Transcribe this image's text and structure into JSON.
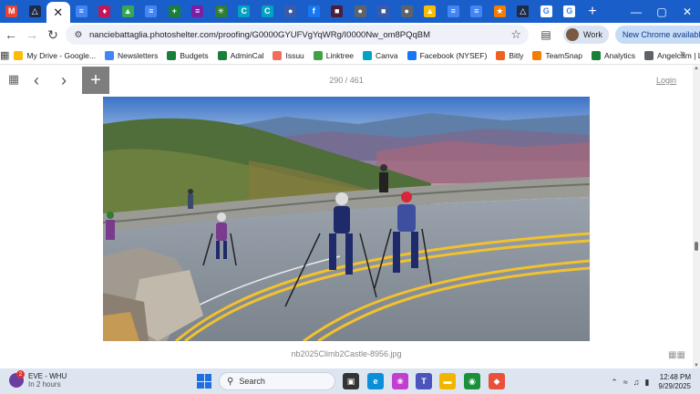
{
  "window": {
    "controls": {
      "minimize": "—",
      "maximize": "▢",
      "close": "✕"
    }
  },
  "tabs": [
    {
      "icon": "gmail-icon",
      "glyph": "M",
      "color": "#ea4335"
    },
    {
      "icon": "photoshelter-icon",
      "glyph": "△",
      "color": "#1c2b4a"
    },
    {
      "icon": "close-tab-icon",
      "glyph": "✕",
      "color": "#ffffff",
      "active": true
    },
    {
      "icon": "docs-icon",
      "glyph": "≡",
      "color": "#4285f4"
    },
    {
      "icon": "app-icon",
      "glyph": "♦",
      "color": "#c2185b"
    },
    {
      "icon": "drive-icon",
      "glyph": "▲",
      "color": "#34a853"
    },
    {
      "icon": "docs-icon",
      "glyph": "≡",
      "color": "#4285f4"
    },
    {
      "icon": "sheets-icon",
      "glyph": "+",
      "color": "#188038"
    },
    {
      "icon": "forms-icon",
      "glyph": "≡",
      "color": "#7b1fa2"
    },
    {
      "icon": "linktree-icon",
      "glyph": "✳",
      "color": "#2e7d32"
    },
    {
      "icon": "canva-icon",
      "glyph": "C",
      "color": "#00a3c4"
    },
    {
      "icon": "canva-icon",
      "glyph": "C",
      "color": "#00a3c4"
    },
    {
      "icon": "app-icon",
      "glyph": "●",
      "color": "#3b5ba9"
    },
    {
      "icon": "facebook-icon",
      "glyph": "f",
      "color": "#1877f2"
    },
    {
      "icon": "app-icon",
      "glyph": "■",
      "color": "#4a1f3a"
    },
    {
      "icon": "app-icon",
      "glyph": "●",
      "color": "#5f6368"
    },
    {
      "icon": "app-icon",
      "glyph": "■",
      "color": "#3b5ba9"
    },
    {
      "icon": "app-icon",
      "glyph": "●",
      "color": "#5f6368"
    },
    {
      "icon": "drive-icon",
      "glyph": "▲",
      "color": "#fbbc04"
    },
    {
      "icon": "docs-icon",
      "glyph": "≡",
      "color": "#4285f4"
    },
    {
      "icon": "docs-icon",
      "glyph": "≡",
      "color": "#4285f4"
    },
    {
      "icon": "app-icon",
      "glyph": "★",
      "color": "#f57c00"
    },
    {
      "icon": "photoshelter-icon",
      "glyph": "△",
      "color": "#1c2b4a"
    },
    {
      "icon": "google-icon",
      "glyph": "G",
      "color": "#ffffff"
    },
    {
      "icon": "google-icon",
      "glyph": "G",
      "color": "#ffffff"
    }
  ],
  "toolbar": {
    "url": "nanciebattaglia.photoshelter.com/proofing/G0000GYUFVgYqWRg/I0000Nw_om8PQqBM",
    "profile_label": "Work",
    "update_label": "New Chrome available"
  },
  "bookmarks": [
    {
      "label": "My Drive - Google...",
      "icon": "drive-icon",
      "color": "#fbbc04"
    },
    {
      "label": "Newsletters",
      "icon": "docs-icon",
      "color": "#4285f4"
    },
    {
      "label": "Budgets",
      "icon": "sheets-icon",
      "color": "#188038"
    },
    {
      "label": "AdminCal",
      "icon": "sheets-icon",
      "color": "#188038"
    },
    {
      "label": "Issuu",
      "icon": "issuu-icon",
      "color": "#f36d5d"
    },
    {
      "label": "Linktree",
      "icon": "linktree-icon",
      "color": "#43a047"
    },
    {
      "label": "Canva",
      "icon": "canva-icon",
      "color": "#00a3c4"
    },
    {
      "label": "Facebook (NYSEF)",
      "icon": "facebook-icon",
      "color": "#1877f2"
    },
    {
      "label": "Bitly",
      "icon": "bitly-icon",
      "color": "#ee6123"
    },
    {
      "label": "TeamSnap",
      "icon": "teamsnap-icon",
      "color": "#f57c00"
    },
    {
      "label": "Analytics",
      "icon": "sheets-icon",
      "color": "#188038"
    },
    {
      "label": "Angelcam | Live vid...",
      "icon": "globe-icon",
      "color": "#5f6368"
    }
  ],
  "viewer": {
    "counter": "290 / 461",
    "login_label": "Login",
    "add_label": "+",
    "caption": "nb2025Climb2Castle-8956.jpg"
  },
  "taskbar": {
    "weather_title": "EVE - WHU",
    "weather_sub": "In 2 hours",
    "weather_badge": "2",
    "search_placeholder": "Search",
    "time": "12:48 PM",
    "date": "9/29/2025",
    "apps": [
      {
        "icon": "task-view-icon",
        "glyph": "▣",
        "color": "#333333"
      },
      {
        "icon": "edge-icon",
        "glyph": "e",
        "color": "#0c8ed9"
      },
      {
        "icon": "copilot-icon",
        "glyph": "❀",
        "color": "#c03fd0"
      },
      {
        "icon": "teams-icon",
        "glyph": "T",
        "color": "#4b53bc"
      },
      {
        "icon": "file-explorer-icon",
        "glyph": "▬",
        "color": "#f2b600"
      },
      {
        "icon": "chrome-icon",
        "glyph": "◉",
        "color": "#1b8f3a"
      },
      {
        "icon": "app-icon",
        "glyph": "◆",
        "color": "#e8523b"
      }
    ]
  }
}
